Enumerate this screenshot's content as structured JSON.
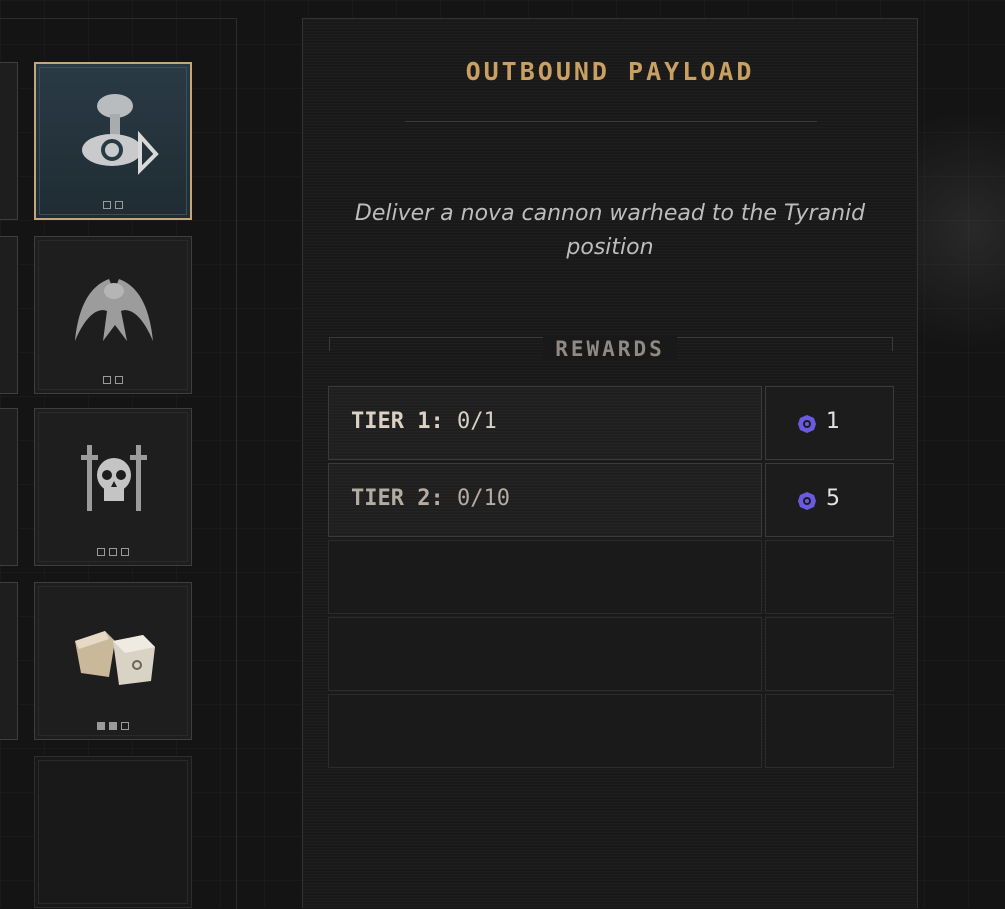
{
  "panel": {
    "title": "OUTBOUND PAYLOAD",
    "description": "Deliver a nova cannon warhead to the Tyranid position",
    "rewards_title": "REWARDS",
    "tiers": [
      {
        "label": "TIER 1:",
        "progress": "0/1",
        "reward_icon": "requisition-icon",
        "reward_amount": "1"
      },
      {
        "label": "TIER 2:",
        "progress": "0/10",
        "reward_icon": "requisition-icon",
        "reward_amount": "5"
      }
    ],
    "empty_rows": 3
  },
  "contracts": [
    {
      "icon": "nova-cannon-blast-icon",
      "selected": true,
      "pips_total": 2,
      "pips_filled": 0
    },
    {
      "icon": "tyranid-lictor-icon",
      "selected": false,
      "pips_total": 2,
      "pips_filled": 0
    },
    {
      "icon": "skull-swords-icon",
      "selected": false,
      "pips_total": 3,
      "pips_filled": 0
    },
    {
      "icon": "supply-crates-icon",
      "selected": false,
      "pips_total": 3,
      "pips_filled": 2
    },
    {
      "icon": "empty-slot",
      "selected": false,
      "pips_total": 0,
      "pips_filled": 0
    }
  ],
  "colors": {
    "accent_gold": "#c99f62",
    "selected_border": "#c5a67a",
    "reward_icon": "#6a5ae0"
  }
}
